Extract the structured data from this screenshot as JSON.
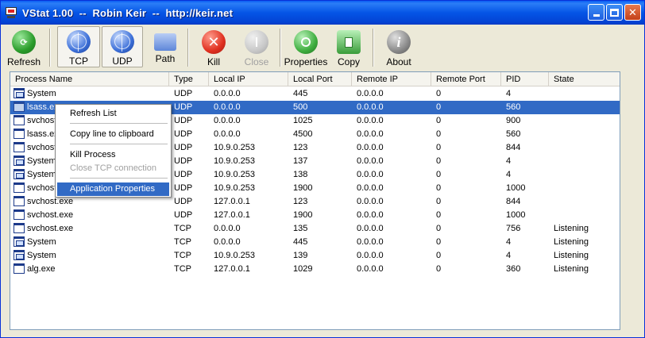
{
  "window": {
    "title": "VStat 1.00  --  Robin Keir  --  http://keir.net",
    "controls": [
      "minimize",
      "maximize",
      "close"
    ]
  },
  "toolbar": {
    "refresh": "Refresh",
    "tcp": "TCP",
    "udp": "UDP",
    "path": "Path",
    "kill": "Kill",
    "close": "Close",
    "properties": "Properties",
    "copy": "Copy",
    "about": "About"
  },
  "columns": [
    "Process Name",
    "Type",
    "Local IP",
    "Local Port",
    "Remote IP",
    "Remote Port",
    "PID",
    "State"
  ],
  "rows": [
    [
      "System",
      "UDP",
      "0.0.0.0",
      "445",
      "0.0.0.0",
      "0",
      "4",
      ""
    ],
    [
      "lsass.exe",
      "UDP",
      "0.0.0.0",
      "500",
      "0.0.0.0",
      "0",
      "560",
      ""
    ],
    [
      "svchost.exe",
      "UDP",
      "0.0.0.0",
      "1025",
      "0.0.0.0",
      "0",
      "900",
      ""
    ],
    [
      "lsass.exe",
      "UDP",
      "0.0.0.0",
      "4500",
      "0.0.0.0",
      "0",
      "560",
      ""
    ],
    [
      "svchost.exe",
      "UDP",
      "10.9.0.253",
      "123",
      "0.0.0.0",
      "0",
      "844",
      ""
    ],
    [
      "System",
      "UDP",
      "10.9.0.253",
      "137",
      "0.0.0.0",
      "0",
      "4",
      ""
    ],
    [
      "System",
      "UDP",
      "10.9.0.253",
      "138",
      "0.0.0.0",
      "0",
      "4",
      ""
    ],
    [
      "svchost.exe",
      "UDP",
      "10.9.0.253",
      "1900",
      "0.0.0.0",
      "0",
      "1000",
      ""
    ],
    [
      "svchost.exe",
      "UDP",
      "127.0.0.1",
      "123",
      "0.0.0.0",
      "0",
      "844",
      ""
    ],
    [
      "svchost.exe",
      "UDP",
      "127.0.0.1",
      "1900",
      "0.0.0.0",
      "0",
      "1000",
      ""
    ],
    [
      "svchost.exe",
      "TCP",
      "0.0.0.0",
      "135",
      "0.0.0.0",
      "0",
      "756",
      "Listening"
    ],
    [
      "System",
      "TCP",
      "0.0.0.0",
      "445",
      "0.0.0.0",
      "0",
      "4",
      "Listening"
    ],
    [
      "System",
      "TCP",
      "10.9.0.253",
      "139",
      "0.0.0.0",
      "0",
      "4",
      "Listening"
    ],
    [
      "alg.exe",
      "TCP",
      "127.0.0.1",
      "1029",
      "0.0.0.0",
      "0",
      "360",
      "Listening"
    ]
  ],
  "selected_row": 1,
  "context_menu": {
    "refresh_list": "Refresh List",
    "copy_line": "Copy line to clipboard",
    "kill_process": "Kill Process",
    "close_tcp": "Close TCP connection",
    "app_properties": "Application Properties"
  },
  "colors": {
    "titlebar": "#0555e6",
    "selection": "#316ac5",
    "window_bg": "#ece9d8"
  }
}
